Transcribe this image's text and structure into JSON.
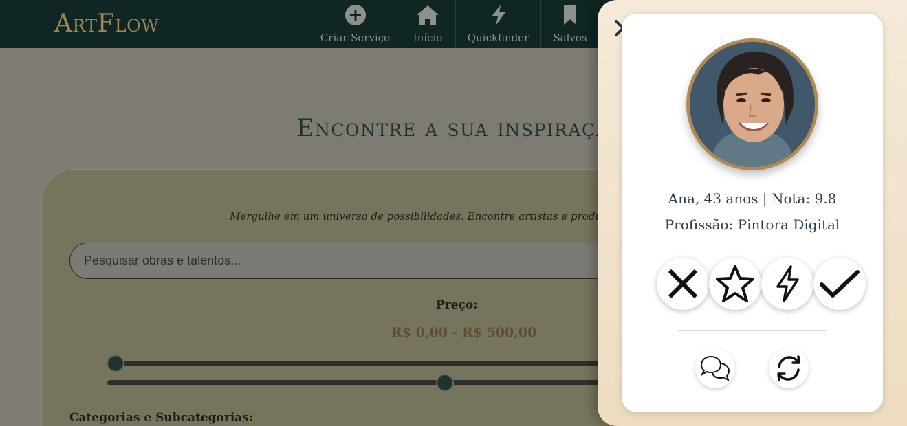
{
  "header": {
    "logo": "ArtFlow",
    "nav": [
      {
        "label": "Criar Serviço",
        "icon": "plus-circle-icon"
      },
      {
        "label": "Início",
        "icon": "home-icon"
      },
      {
        "label": "Quickfinder",
        "icon": "lightning-icon"
      },
      {
        "label": "Salvos",
        "icon": "bookmark-icon"
      }
    ]
  },
  "main": {
    "title": "Encontre a sua inspiração",
    "subtitle": "Mergulhe em um universo de possibilidades. Encontre artistas e produtores com",
    "search": {
      "placeholder": "Pesquisar obras e talentos...",
      "value": ""
    },
    "price": {
      "label": "Preço:",
      "range_text": "R$ 0,00 - R$ 500,00",
      "min": 0,
      "max": 500,
      "min_fraction": 0.0,
      "max_fraction": 0.66
    },
    "categories_label": "Categorias e Subcategorias:"
  },
  "profile_panel": {
    "close_icon": "close-icon",
    "name_line": "Ana, 43 anos | Nota: 9.8",
    "profession_line": "Profissão: Pintora Digital",
    "actions": [
      "reject-icon",
      "star-icon",
      "lightning-icon",
      "check-icon"
    ],
    "secondary_actions": [
      "chat-icon",
      "refresh-icon"
    ]
  },
  "colors": {
    "header_bg": "#0f2624",
    "logo": "#9c8557",
    "panel_bg": "#f5ead9",
    "avatar_border": "#b08a52",
    "text_dark": "#2b3b48",
    "price_text": "#5d4f2f"
  }
}
